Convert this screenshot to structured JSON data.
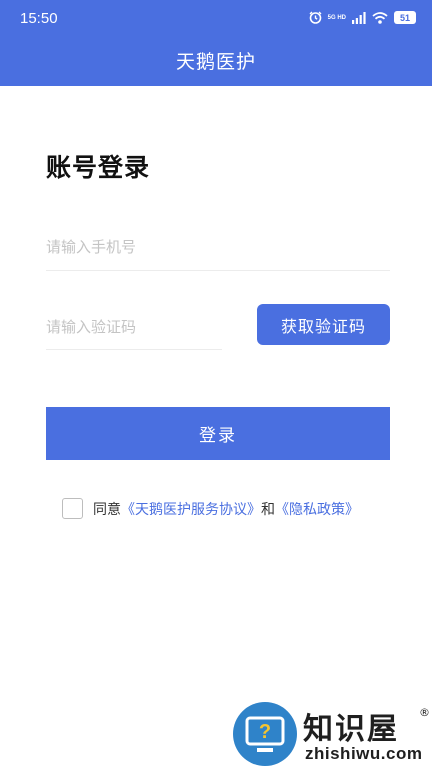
{
  "status_bar": {
    "time": "15:50",
    "network_label": "5G HD",
    "battery_level": "51",
    "icons": [
      "alarm-icon",
      "signal-icon",
      "wifi-icon",
      "battery-icon"
    ]
  },
  "header": {
    "title": "天鹅医护"
  },
  "login": {
    "heading": "账号登录",
    "phone_placeholder": "请输入手机号",
    "code_placeholder": "请输入验证码",
    "get_code_label": "获取验证码",
    "submit_label": "登录"
  },
  "agreement": {
    "prefix": "同意",
    "service_link": "《天鹅医护服务协议》",
    "conjunction": "和",
    "privacy_link": "《隐私政策》",
    "checked": false
  },
  "watermark": {
    "title": "知识屋",
    "registered_mark": "®",
    "domain": "zhishiwu.com"
  },
  "colors": {
    "primary": "#4a6fe0",
    "watermark_blue": "#2f83c9"
  }
}
